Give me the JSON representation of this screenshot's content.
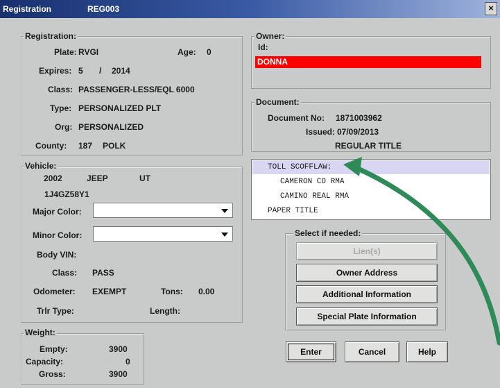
{
  "window": {
    "title": "Registration",
    "record_id": "REG003",
    "close_label": "×"
  },
  "registration": {
    "legend": "Registration:",
    "plate_label": "Plate:",
    "plate": "RVGI",
    "age_label": "Age:",
    "age": "0",
    "expires_label": "Expires:",
    "expires_month": "5",
    "expires_sep": "/",
    "expires_year": "2014",
    "class_label": "Class:",
    "class": "PASSENGER-LESS/EQL 6000",
    "type_label": "Type:",
    "type": "PERSONALIZED PLT",
    "org_label": "Org:",
    "org": "PERSONALIZED",
    "county_label": "County:",
    "county_code": "187",
    "county": "POLK"
  },
  "owner": {
    "legend": "Owner:",
    "id_label": "Id:",
    "name": "DONNA",
    "highlight_color": "#ff0000"
  },
  "document": {
    "legend": "Document:",
    "number_label": "Document No:",
    "number": "1871003962",
    "issued_label": "Issued:",
    "issued": "07/09/2013",
    "title_type": "REGULAR TITLE"
  },
  "remarks": {
    "items": [
      "TOLL SCOFFLAW:",
      "CAMERON CO RMA",
      "CAMINO REAL RMA",
      "PAPER TITLE"
    ],
    "selected_index": 0,
    "selected_color": "#d8d6f2"
  },
  "vehicle": {
    "legend": "Vehicle:",
    "year": "2002",
    "make": "JEEP",
    "model": "UT",
    "vin": "1J4GZ58Y1",
    "major_color_label": "Major Color:",
    "major_color_value": "",
    "minor_color_label": "Minor Color:",
    "minor_color_value": "",
    "body_vin_label": "Body VIN:",
    "class_label": "Class:",
    "class": "PASS",
    "odometer_label": "Odometer:",
    "odometer": "EXEMPT",
    "tons_label": "Tons:",
    "tons": "0.00",
    "trlr_type_label": "Trlr Type:",
    "length_label": "Length:"
  },
  "weight": {
    "legend": "Weight:",
    "empty_label": "Empty:",
    "empty": "3900",
    "capacity_label": "Capacity:",
    "capacity": "0",
    "gross_label": "Gross:",
    "gross": "3900"
  },
  "select_panel": {
    "legend": "Select if needed:",
    "lien_button": "Lien(s)",
    "owner_address_button": "Owner Address",
    "additional_info_button": "Additional Information",
    "special_plate_button": "Special Plate Information"
  },
  "footer": {
    "enter_button": "Enter",
    "cancel_button": "Cancel",
    "help_button": "Help"
  },
  "annotation": {
    "arrow_color": "#2e8b57"
  }
}
